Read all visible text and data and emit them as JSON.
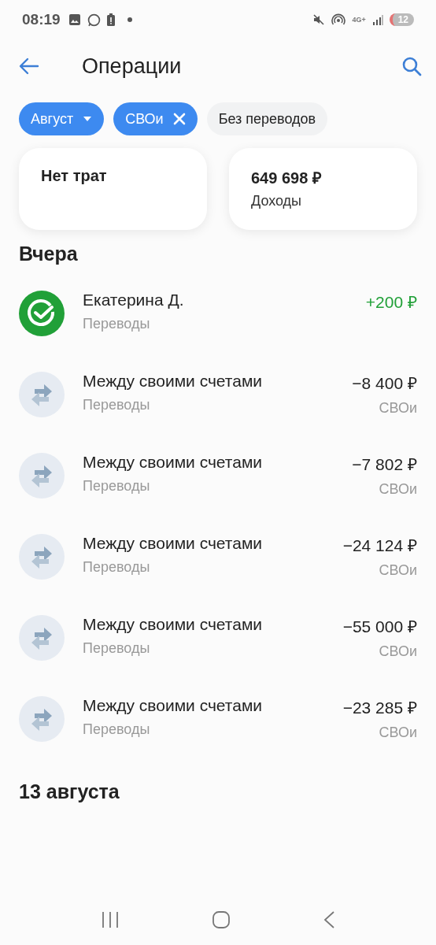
{
  "status_bar": {
    "time": "08:19",
    "network": "4G+",
    "battery": "12"
  },
  "header": {
    "title": "Операции"
  },
  "filters": [
    {
      "label": "Август",
      "kind": "dropdown",
      "selected": true
    },
    {
      "label": "СВОи",
      "kind": "removable",
      "selected": true
    },
    {
      "label": "Без переводов",
      "kind": "toggle",
      "selected": false
    }
  ],
  "summary": [
    {
      "value": "Нет трат"
    },
    {
      "value": "649 698 ₽",
      "caption": "Доходы"
    }
  ],
  "sections": [
    {
      "title": "Вчера",
      "operations": [
        {
          "kind": "person",
          "name": "Екатерина Д.",
          "category": "Переводы",
          "amount": "+200 ₽",
          "income": true
        },
        {
          "kind": "transfer",
          "name": "Между своими счетами",
          "category": "Переводы",
          "amount": "−8 400 ₽",
          "income": false,
          "account": "СВОи"
        },
        {
          "kind": "transfer",
          "name": "Между своими счетами",
          "category": "Переводы",
          "amount": "−7 802 ₽",
          "income": false,
          "account": "СВОи"
        },
        {
          "kind": "transfer",
          "name": "Между своими счетами",
          "category": "Переводы",
          "amount": "−24 124 ₽",
          "income": false,
          "account": "СВОи"
        },
        {
          "kind": "transfer",
          "name": "Между своими счетами",
          "category": "Переводы",
          "amount": "−55 000 ₽",
          "income": false,
          "account": "СВОи"
        },
        {
          "kind": "transfer",
          "name": "Между своими счетами",
          "category": "Переводы",
          "amount": "−23 285 ₽",
          "income": false,
          "account": "СВОи"
        }
      ]
    },
    {
      "title": "13 августа"
    }
  ]
}
